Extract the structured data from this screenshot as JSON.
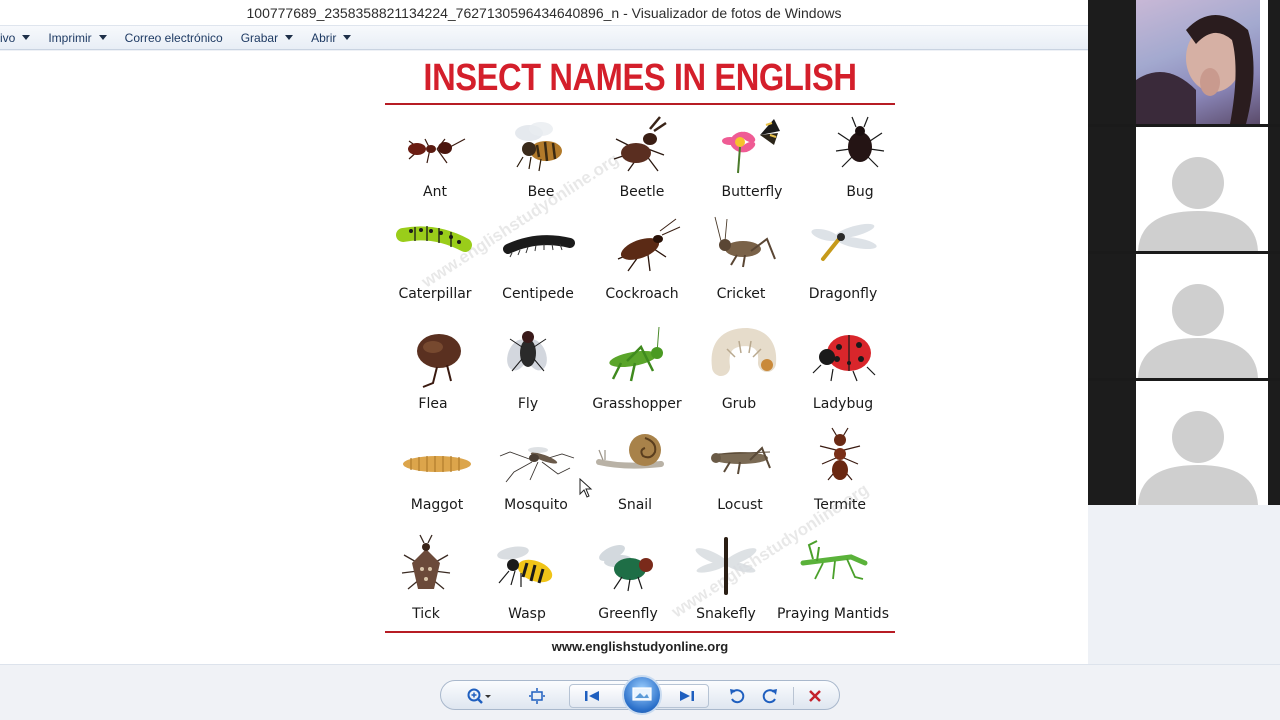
{
  "window": {
    "title": "100777689_2358358821134224_7627130596434640896_n - Visualizador de fotos de Windows"
  },
  "menu": {
    "items": [
      {
        "label": "ivo",
        "has_arrow": true
      },
      {
        "label": "Imprimir",
        "has_arrow": true
      },
      {
        "label": "Correo electrónico",
        "has_arrow": false
      },
      {
        "label": "Grabar",
        "has_arrow": true
      },
      {
        "label": "Abrir",
        "has_arrow": true
      }
    ]
  },
  "poster": {
    "title": "INSECT NAMES IN ENGLISH",
    "website": "www.englishstudyonline.org",
    "watermark": "www.englishstudyonline.org",
    "insects": [
      {
        "name": "Ant",
        "icon": "ant-icon"
      },
      {
        "name": "Bee",
        "icon": "bee-icon"
      },
      {
        "name": "Beetle",
        "icon": "beetle-icon"
      },
      {
        "name": "Butterfly",
        "icon": "butterfly-icon"
      },
      {
        "name": "Bug",
        "icon": "bug-icon"
      },
      {
        "name": "Caterpillar",
        "icon": "caterpillar-icon"
      },
      {
        "name": "Centipede",
        "icon": "centipede-icon"
      },
      {
        "name": "Cockroach",
        "icon": "cockroach-icon"
      },
      {
        "name": "Cricket",
        "icon": "cricket-icon"
      },
      {
        "name": "Dragonfly",
        "icon": "dragonfly-icon"
      },
      {
        "name": "Flea",
        "icon": "flea-icon"
      },
      {
        "name": "Fly",
        "icon": "fly-icon"
      },
      {
        "name": "Grasshopper",
        "icon": "grasshopper-icon"
      },
      {
        "name": "Grub",
        "icon": "grub-icon"
      },
      {
        "name": "Ladybug",
        "icon": "ladybug-icon"
      },
      {
        "name": "Maggot",
        "icon": "maggot-icon"
      },
      {
        "name": "Mosquito",
        "icon": "mosquito-icon"
      },
      {
        "name": "Snail",
        "icon": "snail-icon"
      },
      {
        "name": "Locust",
        "icon": "locust-icon"
      },
      {
        "name": "Termite",
        "icon": "termite-icon"
      },
      {
        "name": "Tick",
        "icon": "tick-icon"
      },
      {
        "name": "Wasp",
        "icon": "wasp-icon"
      },
      {
        "name": "Greenfly",
        "icon": "greenfly-icon"
      },
      {
        "name": "Snakefly",
        "icon": "snakefly-icon"
      },
      {
        "name": "Praying Mantids",
        "icon": "praying-mantis-icon"
      }
    ]
  },
  "toolbar": {
    "buttons": [
      {
        "name": "zoom-button",
        "icon": "magnifier-icon"
      },
      {
        "name": "actual-size-button",
        "icon": "fit-window-icon"
      },
      {
        "name": "previous-button",
        "icon": "skip-back-icon"
      },
      {
        "name": "slideshow-button",
        "icon": "slideshow-icon"
      },
      {
        "name": "next-button",
        "icon": "skip-forward-icon"
      },
      {
        "name": "rotate-left-button",
        "icon": "rotate-ccw-icon"
      },
      {
        "name": "rotate-right-button",
        "icon": "rotate-cw-icon"
      },
      {
        "name": "delete-button",
        "icon": "delete-x-icon"
      }
    ]
  },
  "participants": [
    {
      "kind": "video",
      "icon": "participant-video"
    },
    {
      "kind": "avatar",
      "icon": "avatar-placeholder-icon"
    },
    {
      "kind": "avatar",
      "icon": "avatar-placeholder-icon"
    },
    {
      "kind": "avatar",
      "icon": "avatar-placeholder-icon"
    }
  ],
  "colors": {
    "title_red": "#d41f2b",
    "rule_red": "#b71c24",
    "menu_text": "#1e3a63",
    "delete_red": "#c4212b",
    "nav_blue": "#1f5fbf"
  }
}
